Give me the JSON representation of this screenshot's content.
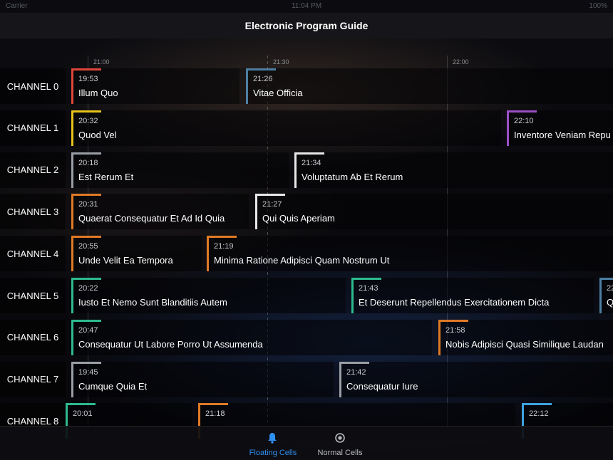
{
  "status_bar": {
    "carrier": "Carrier",
    "time": "11:04 PM",
    "battery": "100%"
  },
  "nav": {
    "title": "Electronic Program Guide"
  },
  "timeline": {
    "ticks": [
      "21:00",
      "21:30",
      "22:00"
    ]
  },
  "colors": {
    "red": "#e0463a",
    "blue_gray": "#4d7ea3",
    "yellow": "#e6c21c",
    "purple": "#9b4fc6",
    "gray": "#9a9fa6",
    "white": "#e8e8e8",
    "orange": "#e07a24",
    "green": "#2dba8f",
    "sky": "#3ea3e0",
    "tab_active": "#2f8ff0",
    "tab_inactive": "#b8bbbf"
  },
  "channels": [
    {
      "label": "CHANNEL 0",
      "programs": [
        {
          "time": "19:53",
          "title": "Illum Quo",
          "color": "red"
        },
        {
          "time": "21:26",
          "title": "Vitae Officia",
          "color": "blue_gray"
        }
      ]
    },
    {
      "label": "CHANNEL 1",
      "programs": [
        {
          "time": "20:32",
          "title": "Quod Vel",
          "color": "yellow"
        },
        {
          "time": "22:10",
          "title": "Inventore Veniam Repu",
          "color": "purple"
        }
      ]
    },
    {
      "label": "CHANNEL 2",
      "programs": [
        {
          "time": "20:18",
          "title": "Est Rerum Et",
          "color": "gray"
        },
        {
          "time": "21:34",
          "title": "Voluptatum Ab Et Rerum",
          "color": "white"
        }
      ]
    },
    {
      "label": "CHANNEL 3",
      "programs": [
        {
          "time": "20:31",
          "title": "Quaerat Consequatur Et Ad Id Quia",
          "color": "orange"
        },
        {
          "time": "21:27",
          "title": "Qui Quis Aperiam",
          "color": "white"
        }
      ]
    },
    {
      "label": "CHANNEL 4",
      "programs": [
        {
          "time": "20:55",
          "title": "Unde Velit Ea Tempora",
          "color": "orange"
        },
        {
          "time": "21:19",
          "title": "Minima Ratione Adipisci Quam Nostrum Ut",
          "color": "orange"
        }
      ]
    },
    {
      "label": "CHANNEL 5",
      "programs": [
        {
          "time": "20:22",
          "title": "Iusto Et Nemo Sunt Blanditiis Autem",
          "color": "green"
        },
        {
          "time": "21:43",
          "title": "Et Deserunt Repellendus Exercitationem Dicta",
          "color": "green"
        },
        {
          "time": "22",
          "title": "Q",
          "color": "blue_gray"
        }
      ]
    },
    {
      "label": "CHANNEL 6",
      "programs": [
        {
          "time": "20:47",
          "title": "Consequatur Ut Labore Porro Ut Assumenda",
          "color": "green"
        },
        {
          "time": "21:58",
          "title": "Nobis Adipisci Quasi Similique Laudan",
          "color": "orange"
        }
      ]
    },
    {
      "label": "CHANNEL 7",
      "programs": [
        {
          "time": "19:45",
          "title": "Cumque Quia Et",
          "color": "gray"
        },
        {
          "time": "21:42",
          "title": "Consequatur Iure",
          "color": "gray"
        }
      ]
    },
    {
      "label": "CHANNEL 8",
      "programs": [
        {
          "time": "20:01",
          "title": "",
          "color": "green"
        },
        {
          "time": "21:18",
          "title": "",
          "color": "orange"
        },
        {
          "time": "22:12",
          "title": "",
          "color": "sky"
        }
      ]
    }
  ],
  "tabs": [
    {
      "label": "Floating Cells",
      "icon": "bell-icon",
      "active": true
    },
    {
      "label": "Normal Cells",
      "icon": "target-icon",
      "active": false
    }
  ]
}
